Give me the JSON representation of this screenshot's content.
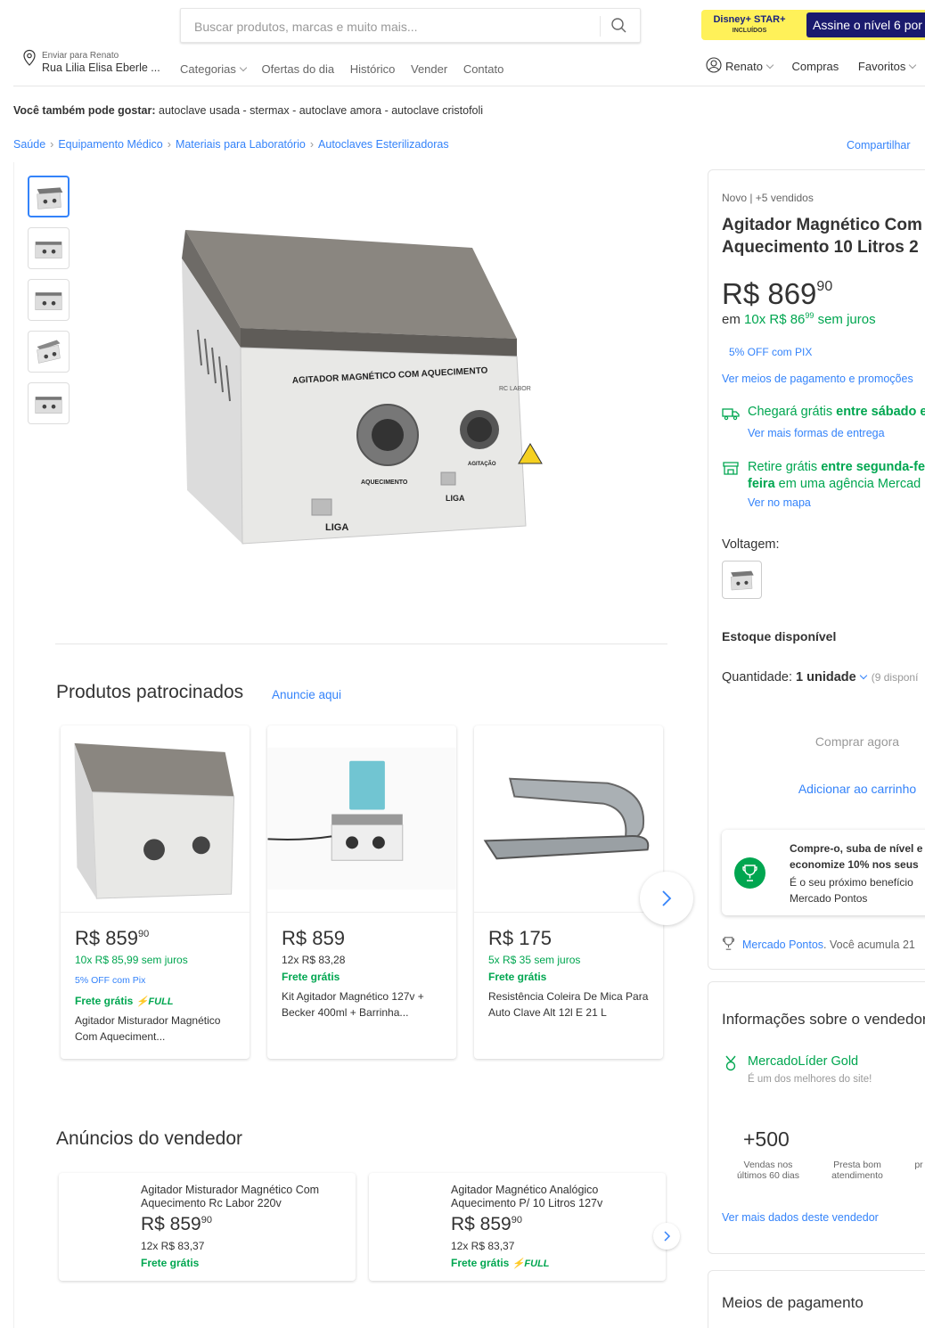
{
  "header": {
    "search_placeholder": "Buscar produtos, marcas e muito mais...",
    "promo_brand": "Disney+ STAR+",
    "promo_brand_sub": "INCLUÍDOS",
    "promo_button": "Assine o nível 6 por",
    "location_line1": "Enviar para Renato",
    "location_line2": "Rua Lilia Elisa Eberle ...",
    "nav": [
      "Categorias",
      "Ofertas do dia",
      "Histórico",
      "Vender",
      "Contato"
    ],
    "user_name": "Renato",
    "purchases": "Compras",
    "favorites": "Favoritos"
  },
  "also_like": {
    "label": "Você também pode gostar:",
    "text": " autoclave usada - stermax - autoclave amora - autoclave cristofoli"
  },
  "breadcrumb": [
    "Saúde",
    "Equipamento Médico",
    "Materiais para Laboratório",
    "Autoclaves Esterilizadoras"
  ],
  "share": "Compartilhar",
  "product": {
    "condition": "Novo  |  +5 vendidos",
    "title_line1": "Agitador Magnético Com",
    "title_line2": "Aquecimento 10 Litros 2",
    "price_int": "R$ 869",
    "price_cents": "90",
    "inst_prefix": "em ",
    "inst_main": "10x R$ 86",
    "inst_cents": "99",
    "inst_suffix": " sem juros",
    "pix": "5% OFF com PIX",
    "payments_link": "Ver meios de pagamento e promoções",
    "ship_a": "Chegará grátis ",
    "ship_b": "entre sábado e",
    "ship_more": "Ver mais formas de entrega",
    "pick_a": "Retire grátis ",
    "pick_b": "entre segunda-fe",
    "pick_c": "feira",
    "pick_d": " em uma agência Mercad",
    "pick_map": "Ver no mapa",
    "voltage_label": "Voltagem:",
    "stock": "Estoque disponível",
    "qty_label": "Quantidade: ",
    "qty_value": "1 unidade",
    "qty_avail": "(9 disponí",
    "buy_now": "Comprar agora",
    "add_cart": "Adicionar ao carrinho",
    "level_a1": "Compre-o, suba de nível e",
    "level_a2": "economize 10% nos seus",
    "level_b1": "É o seu próximo benefício",
    "level_b2": "Mercado Pontos",
    "points_link": "Mercado Pontos",
    "points_text": ". Você acumula 21"
  },
  "seller": {
    "title": "Informações sobre o vendedor",
    "badge": "MercadoLíder Gold",
    "badge_sub": "É um dos melhores do site!",
    "sales": "+500",
    "stat1_a": "Vendas nos",
    "stat1_b": "últimos 60 dias",
    "stat2_a": "Presta bom",
    "stat2_b": "atendimento",
    "stat3_a": "",
    "stat3_b": "pr",
    "more": "Ver mais dados deste vendedor"
  },
  "payment_methods_title": "Meios de pagamento",
  "sponsored": {
    "title": "Produtos patrocinados",
    "link": "Anuncie aqui",
    "cards": [
      {
        "price": "R$ 859",
        "cents": "90",
        "inst": "10x R$ 85,99 sem juros",
        "pix": "5% OFF com Pix",
        "ship": "Frete grátis",
        "full": "FULL",
        "title": "Agitador Misturador Magnético Com Aqueciment..."
      },
      {
        "price": "R$ 859",
        "cents": "",
        "inst": "12x R$ 83,28",
        "pix": "",
        "ship": "Frete grátis",
        "full": "",
        "title": "Kit Agitador Magnético 127v + Becker 400ml + Barrinha..."
      },
      {
        "price": "R$ 175",
        "cents": "",
        "inst": "5x R$ 35 sem juros",
        "pix": "",
        "ship": "Frete grátis",
        "full": "",
        "title": "Resistência Coleira De Mica Para Auto Clave Alt 12l E 21 L"
      }
    ]
  },
  "seller_ads": {
    "title": "Anúncios do vendedor",
    "items": [
      {
        "title": "Agitador Misturador Magnético Com Aquecimento Rc Labor 220v",
        "price": "R$ 859",
        "cents": "90",
        "inst": "12x R$ 83,37",
        "ship": "Frete grátis",
        "full": ""
      },
      {
        "title": "Agitador Magnético Analógico Aquecimento P/ 10 Litros 127v",
        "price": "R$ 859",
        "cents": "90",
        "inst": "12x R$ 83,37",
        "ship": "Frete grátis",
        "full": "FULL"
      }
    ]
  },
  "image_text": {
    "panel": "AGITADOR MAGNÉTICO COM AQUECIMENTO",
    "liga": "LIGA",
    "aquecimento": "AQUECIMENTO",
    "agitacao": "AGITAÇÃO",
    "brand": "RC LABOR"
  },
  "colors": {
    "accent": "#3483fa",
    "green": "#00a650",
    "promo_yellow": "#fff159"
  }
}
